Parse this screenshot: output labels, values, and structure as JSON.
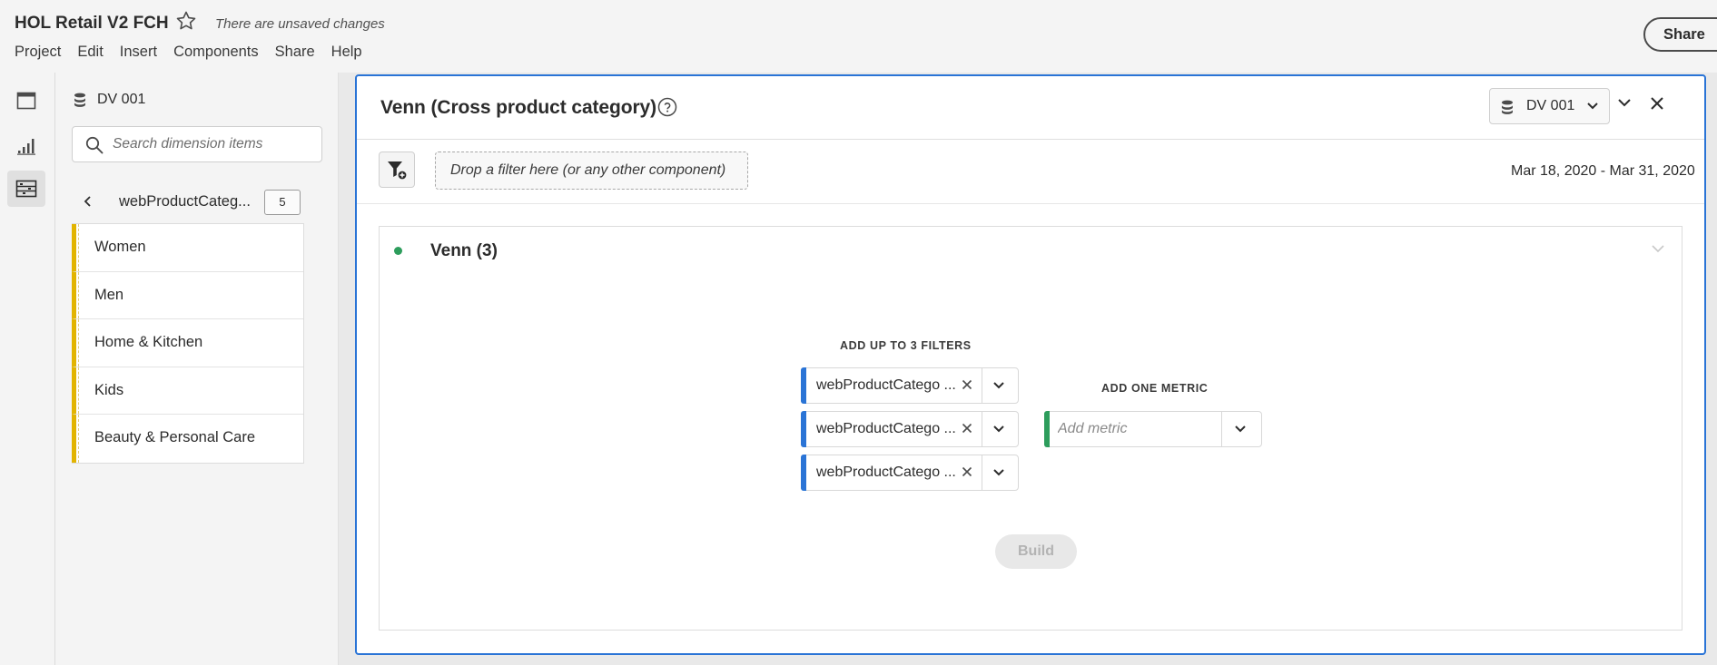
{
  "header": {
    "title": "HOL Retail V2 FCH",
    "unsaved_notice": "There are unsaved changes",
    "share_label": "Share",
    "menu": [
      "Project",
      "Edit",
      "Insert",
      "Components",
      "Share",
      "Help"
    ]
  },
  "rail": {
    "items": [
      {
        "icon": "panels-icon",
        "active": false
      },
      {
        "icon": "visualizations-icon",
        "active": false
      },
      {
        "icon": "components-icon",
        "active": true
      }
    ]
  },
  "component_panel": {
    "data_view": "DV 001",
    "search_placeholder": "Search dimension items",
    "breadcrumb_label": "webProductCateg...",
    "item_count": "5",
    "items": [
      "Women",
      "Men",
      "Home & Kitchen",
      "Kids",
      "Beauty & Personal Care"
    ],
    "item_accent_color": "#e2b400"
  },
  "panel": {
    "title": "Venn (Cross product category)",
    "data_view": "DV 001",
    "drop_zone_text": "Drop a filter here (or any other component)",
    "date_range": "Mar 18, 2020 - Mar 31, 2020",
    "accent_color": "#2a74d6"
  },
  "visualization": {
    "title": "Venn (3)",
    "status_color": "#2d9d5c",
    "filters_heading": "ADD UP TO 3 FILTERS",
    "filters": [
      "webProductCatego ...",
      "webProductCatego ...",
      "webProductCatego ..."
    ],
    "metric_heading": "ADD ONE METRIC",
    "metric_placeholder": "Add metric",
    "build_label": "Build"
  }
}
